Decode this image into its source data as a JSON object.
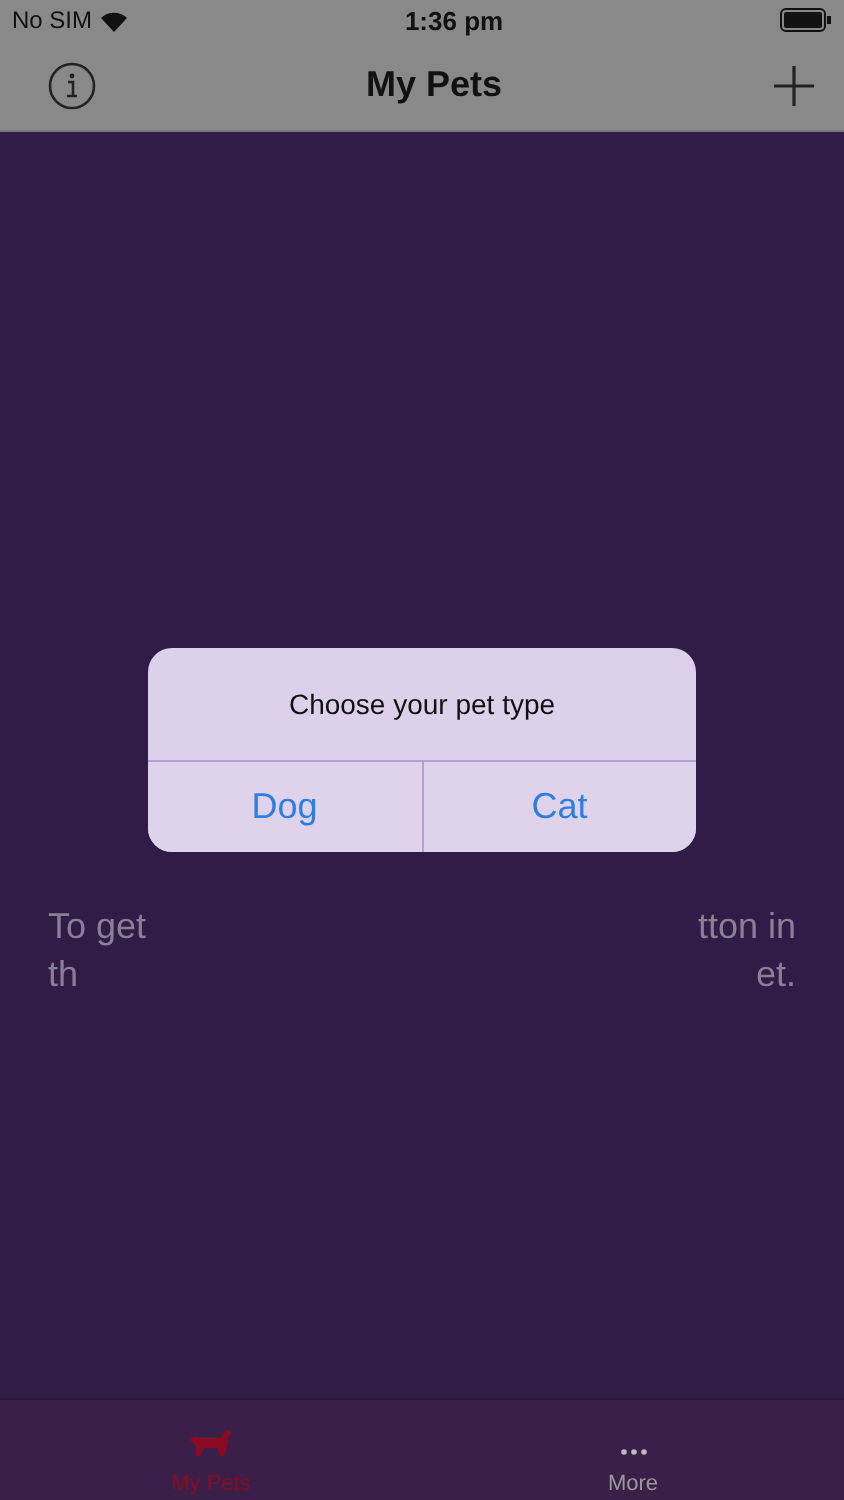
{
  "status_bar": {
    "carrier": "No SIM",
    "time": "1:36 pm"
  },
  "nav_bar": {
    "title": "My Pets"
  },
  "background_text": [
    {
      "left": "To get",
      "right": "tton in"
    },
    {
      "left": "th",
      "right": "et."
    }
  ],
  "alert": {
    "title": "Choose your pet type",
    "actions": [
      "Dog",
      "Cat"
    ]
  },
  "tab_bar": [
    {
      "label": "My Pets",
      "kind": "pet",
      "selected": true
    },
    {
      "label": "More",
      "kind": "more",
      "selected": false
    }
  ]
}
